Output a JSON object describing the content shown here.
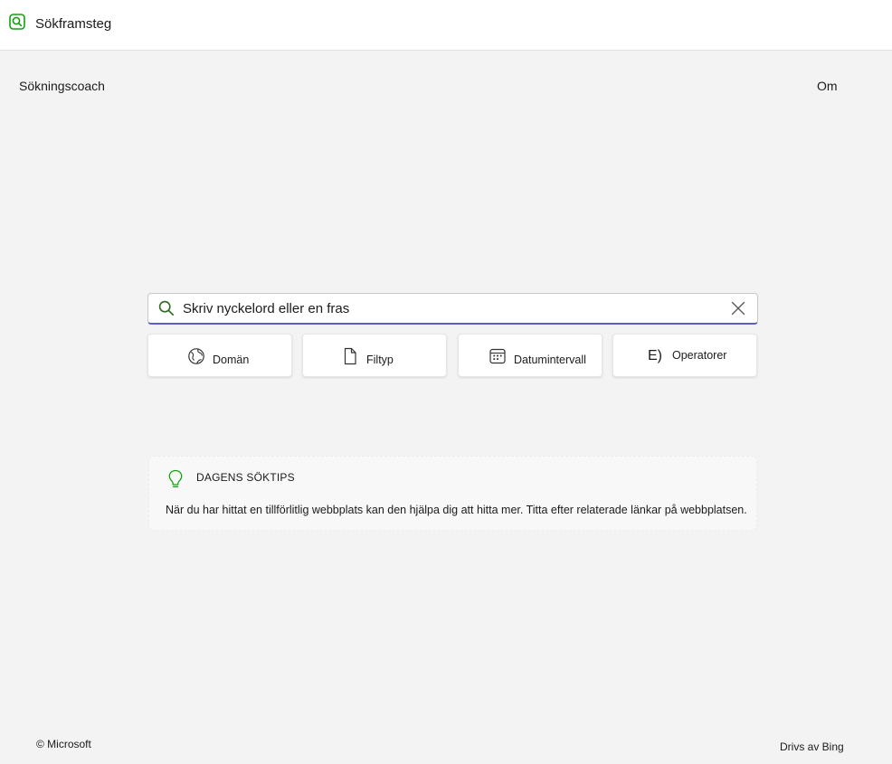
{
  "app": {
    "title": "Sökframsteg",
    "icon": "search-icon",
    "accent_color": "#13a10e"
  },
  "nav": {
    "left_label": "Sökningscoach",
    "right_label": "Om"
  },
  "search": {
    "placeholder": "Skriv nyckelord eller en fras",
    "value": "",
    "focus_color": "#5b5fc7"
  },
  "filters": [
    {
      "label": "Domän",
      "icon": "globe-icon"
    },
    {
      "label": "Filtyp",
      "icon": "file-icon"
    },
    {
      "label": "Datumintervall",
      "icon": "calendar-icon"
    },
    {
      "label": "Operatorer",
      "icon": "operators-icon",
      "glyph": "E)"
    }
  ],
  "tip": {
    "heading": "DAGENS SÖKTIPS",
    "text": "När du har hittat en tillförlitlig webbplats kan den hjälpa dig att hitta mer. Titta efter relaterade länkar på webbplatsen.",
    "icon": "lightbulb-icon",
    "icon_color": "#13a10e"
  },
  "footer": {
    "copyright": "© Microsoft",
    "powered_by": "Drivs av Bing"
  }
}
